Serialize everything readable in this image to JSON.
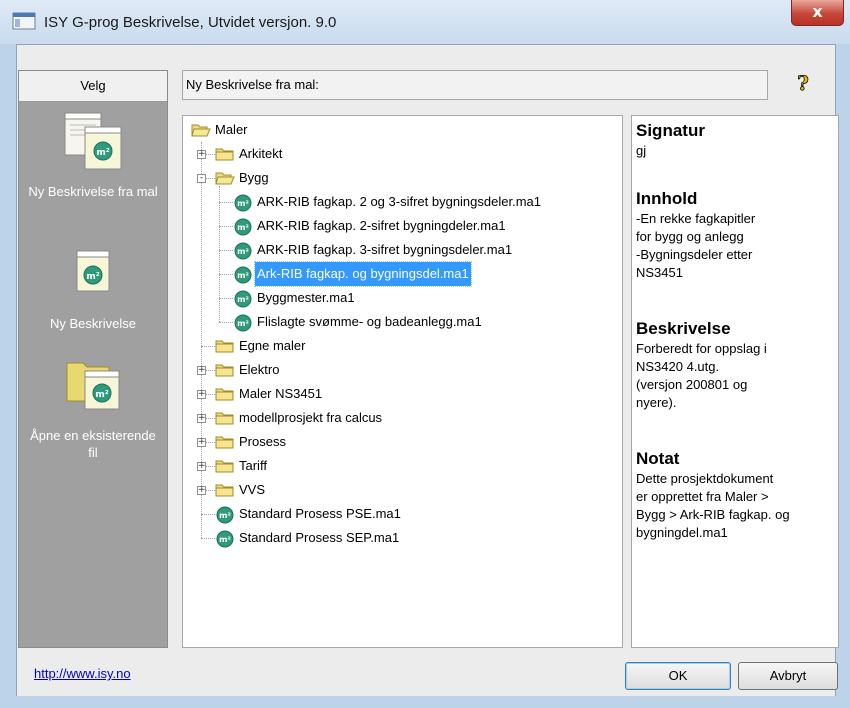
{
  "window": {
    "title": "ISY G-prog Beskrivelse, Utvidet versjon. 9.0",
    "close_label": "x"
  },
  "left_panel": {
    "header": "Velg",
    "items": [
      {
        "label": "Ny Beskrivelse fra mal",
        "icon": "new-from-template-icon"
      },
      {
        "label": "Ny Beskrivelse",
        "icon": "new-document-icon"
      },
      {
        "label": "Åpne en eksisterende fil",
        "icon": "open-folder-icon"
      }
    ]
  },
  "header_field": {
    "label": "Ny Beskrivelse fra mal:"
  },
  "help": {
    "icon": "help-icon"
  },
  "tree": {
    "root": "Maler",
    "items": [
      {
        "label": "Arkitekt",
        "type": "folder",
        "level": 1,
        "expander": "+"
      },
      {
        "label": "Bygg",
        "type": "folder-open",
        "level": 1,
        "expander": "-"
      },
      {
        "label": "ARK-RIB fagkap. 2 og 3-sifret bygningsdeler.ma1",
        "type": "file",
        "level": 2
      },
      {
        "label": "ARK-RIB fagkap. 2-sifret bygningdeler.ma1",
        "type": "file",
        "level": 2
      },
      {
        "label": "ARK-RIB fagkap. 3-sifret bygningsdeler.ma1",
        "type": "file",
        "level": 2
      },
      {
        "label": "Ark-RIB fagkap. og bygningsdel.ma1",
        "type": "file",
        "level": 2,
        "selected": true
      },
      {
        "label": "Byggmester.ma1",
        "type": "file",
        "level": 2
      },
      {
        "label": "Flislagte svømme- og badeanlegg.ma1",
        "type": "file",
        "level": 2
      },
      {
        "label": "Egne maler",
        "type": "folder",
        "level": 1,
        "expander": ""
      },
      {
        "label": "Elektro",
        "type": "folder",
        "level": 1,
        "expander": "+"
      },
      {
        "label": "Maler NS3451",
        "type": "folder",
        "level": 1,
        "expander": "+"
      },
      {
        "label": "modellprosjekt fra calcus",
        "type": "folder",
        "level": 1,
        "expander": "+"
      },
      {
        "label": "Prosess",
        "type": "folder",
        "level": 1,
        "expander": "+"
      },
      {
        "label": "Tariff",
        "type": "folder",
        "level": 1,
        "expander": "+"
      },
      {
        "label": "VVS",
        "type": "folder",
        "level": 1,
        "expander": "+"
      },
      {
        "label": "Standard Prosess PSE.ma1",
        "type": "file",
        "level": 1
      },
      {
        "label": "Standard Prosess SEP.ma1",
        "type": "file",
        "level": 1
      }
    ]
  },
  "info": {
    "sections": [
      {
        "heading": "Signatur",
        "body": "gj"
      },
      {
        "heading": "Innhold",
        "body": "-En rekke fagkapitler\n for bygg og anlegg\n-Bygningsdeler etter\n NS3451"
      },
      {
        "heading": "Beskrivelse",
        "body": "Forberedt for oppslag i\nNS3420  4.utg.\n(versjon 200801 og\nnyere)."
      },
      {
        "heading": "Notat",
        "body": "Dette prosjektdokument\ner opprettet fra Maler >\nBygg > Ark-RIB fagkap. og\nbygningdel.ma1"
      }
    ]
  },
  "footer": {
    "link": "http://www.isy.no",
    "ok_label": "OK",
    "cancel_label": "Avbryt"
  }
}
